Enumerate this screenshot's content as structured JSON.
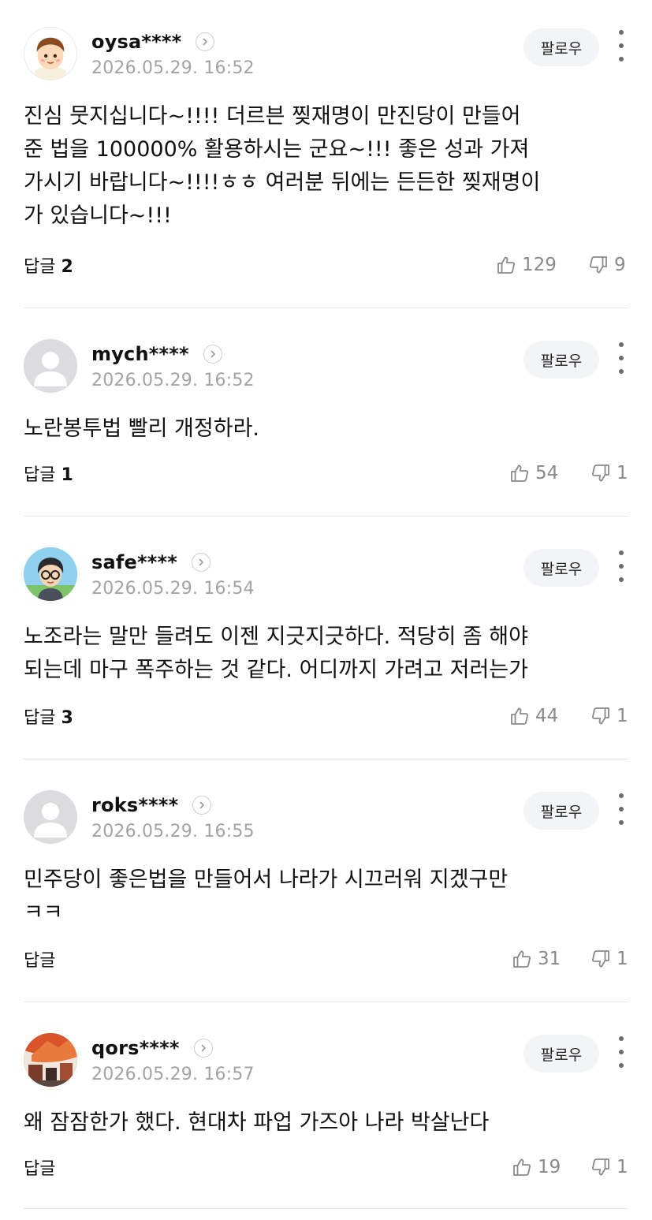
{
  "comments": [
    {
      "author": "oysa****",
      "date": "2026.05.29. 16:52",
      "follow_label": "팔로우",
      "avatar": "cartoon-face-avatar",
      "text": "진심 뭇지십니다~!!!! 더르븐 찢재명이 만진당이 만들어\n준 법을 100000% 활용하시는 군요~!!! 좋은 성과 가져\n가시기 바랍니다~!!!!ㅎㅎ 여러분 뒤에는 든든한 찢재명이\n가 있습니다~!!!",
      "reply_label": "답글",
      "reply_count": "2",
      "likes": "129",
      "dislikes": "9"
    },
    {
      "author": "mych****",
      "date": "2026.05.29. 16:52",
      "follow_label": "팔로우",
      "avatar": "default-user-avatar",
      "text": "노란봉투법 빨리 개정하라.",
      "reply_label": "답글",
      "reply_count": "1",
      "likes": "54",
      "dislikes": "1"
    },
    {
      "author": "safe****",
      "date": "2026.05.29. 16:54",
      "follow_label": "팔로우",
      "avatar": "glasses-character-avatar",
      "text": "노조라는 말만 들려도 이젠 지긋지긋하다. 적당히 좀 해야\n되는데 마구 폭주하는 것 같다. 어디까지 가려고 저러는가",
      "reply_label": "답글",
      "reply_count": "3",
      "likes": "44",
      "dislikes": "1"
    },
    {
      "author": "roks****",
      "date": "2026.05.29. 16:55",
      "follow_label": "팔로우",
      "avatar": "default-user-avatar",
      "text": "민주당이 좋은법을 만들어서 나라가 시끄러워 지겠구만\nㅋㅋ",
      "reply_label": "답글",
      "reply_count": "",
      "likes": "31",
      "dislikes": "1"
    },
    {
      "author": "qors****",
      "date": "2026.05.29. 16:57",
      "follow_label": "팔로우",
      "avatar": "photo-avatar",
      "text": "왜 잠잠한가 했다. 현대차 파업 가즈아 나라 박살난다",
      "reply_label": "답글",
      "reply_count": "",
      "likes": "19",
      "dislikes": "1"
    }
  ],
  "icons": {
    "like": "thumbs-up-icon",
    "dislike": "thumbs-down-icon",
    "profile_link": "chevron-right-icon",
    "more": "more-vertical-icon"
  },
  "colors": {
    "text": "#111111",
    "meta": "#a3a3a3",
    "count": "#8a8a8a",
    "follow_bg": "#f3f4f6",
    "divider": "#e6e6e6"
  }
}
